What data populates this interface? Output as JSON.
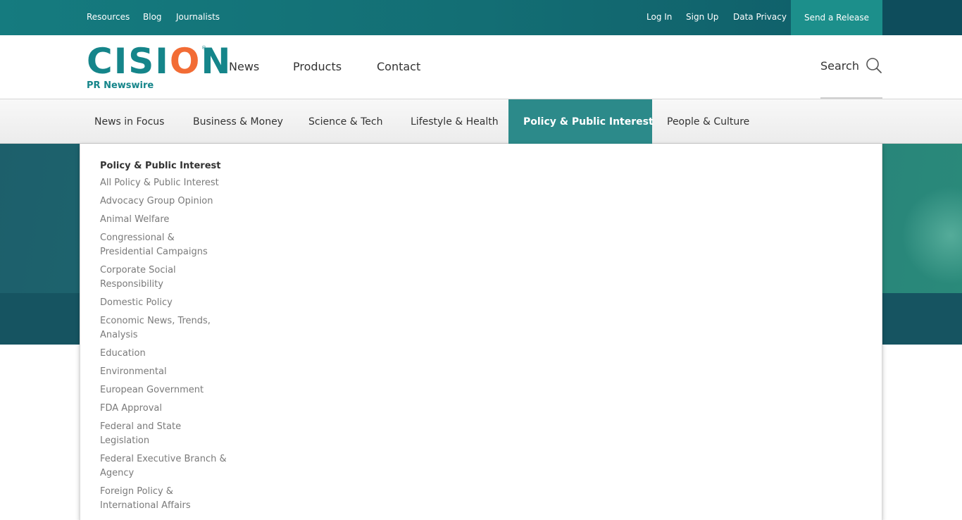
{
  "topbar": {
    "left_links": [
      "Resources",
      "Blog",
      "Journalists"
    ],
    "right_links": [
      "Log In",
      "Sign Up",
      "Data Privacy"
    ],
    "send_release": "Send a Release"
  },
  "logo": {
    "word_start": "CISI",
    "word_o": "O",
    "word_end": "N",
    "sub": "PR Newswire",
    "reg": "®"
  },
  "main_nav": [
    "News",
    "Products",
    "Contact"
  ],
  "search": {
    "label": "Search"
  },
  "categories": [
    {
      "label": "News in Focus",
      "active": false
    },
    {
      "label": "Business & Money",
      "active": false
    },
    {
      "label": "Science & Tech",
      "active": false
    },
    {
      "label": "Lifestyle & Health",
      "active": false
    },
    {
      "label": "Policy & Public Interest",
      "active": true
    },
    {
      "label": "People & Culture",
      "active": false
    }
  ],
  "dropdown": {
    "title": "Policy & Public Interest",
    "items": [
      "All Policy & Public Interest",
      "Advocacy Group Opinion",
      "Animal Welfare",
      "Congressional & Presidential Campaigns",
      "Corporate Social Responsibility",
      "Domestic Policy",
      "Economic News, Trends, Analysis",
      "Education",
      "Environmental",
      "European Government",
      "FDA Approval",
      "Federal and State Legislation",
      "Federal Executive Branch & Agency",
      "Foreign Policy & International Affairs"
    ]
  },
  "colors": {
    "brand_teal": "#15858a",
    "brand_orange": "#f26c35",
    "active_tab": "#2c8a8a"
  }
}
